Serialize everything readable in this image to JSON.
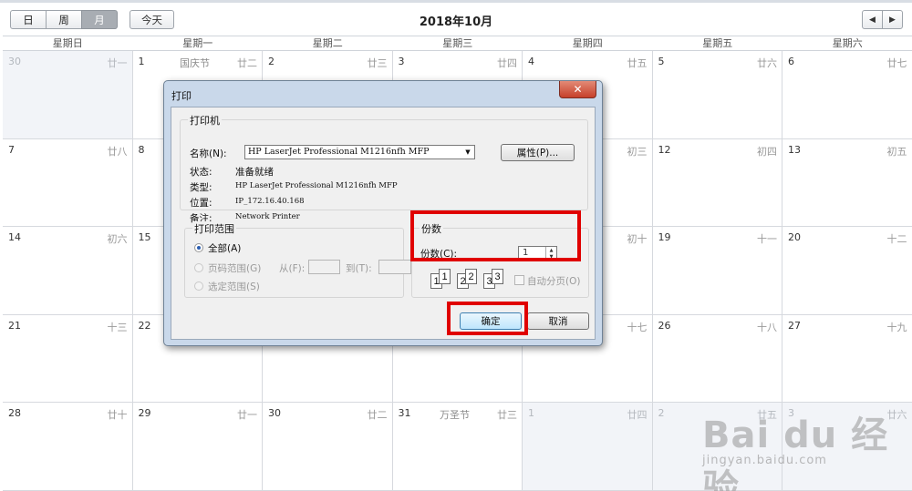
{
  "toolbar": {
    "view_day": "日",
    "view_week": "周",
    "view_month": "月",
    "today": "今天",
    "title": "2018年10月",
    "prev_icon": "◀",
    "next_icon": "▶"
  },
  "weekdays": [
    "星期日",
    "星期一",
    "星期二",
    "星期三",
    "星期四",
    "星期五",
    "星期六"
  ],
  "weeks": [
    [
      {
        "day": "30",
        "holiday": "",
        "lunar": "廿一",
        "other": true
      },
      {
        "day": "1",
        "holiday": "国庆节",
        "lunar": "廿二",
        "other": false
      },
      {
        "day": "2",
        "holiday": "",
        "lunar": "廿三",
        "other": false
      },
      {
        "day": "3",
        "holiday": "",
        "lunar": "廿四",
        "other": false
      },
      {
        "day": "4",
        "holiday": "",
        "lunar": "廿五",
        "other": false
      },
      {
        "day": "5",
        "holiday": "",
        "lunar": "廿六",
        "other": false
      },
      {
        "day": "6",
        "holiday": "",
        "lunar": "廿七",
        "other": false
      }
    ],
    [
      {
        "day": "7",
        "holiday": "",
        "lunar": "廿八",
        "other": false
      },
      {
        "day": "8",
        "holiday": "",
        "lunar": "",
        "other": false
      },
      {
        "day": "",
        "holiday": "",
        "lunar": "",
        "other": false
      },
      {
        "day": "",
        "holiday": "",
        "lunar": "",
        "other": false
      },
      {
        "day": "",
        "holiday": "",
        "lunar": "初三",
        "other": false
      },
      {
        "day": "12",
        "holiday": "",
        "lunar": "初四",
        "other": false
      },
      {
        "day": "13",
        "holiday": "",
        "lunar": "初五",
        "other": false
      }
    ],
    [
      {
        "day": "14",
        "holiday": "",
        "lunar": "初六",
        "other": false
      },
      {
        "day": "15",
        "holiday": "",
        "lunar": "",
        "other": false
      },
      {
        "day": "",
        "holiday": "",
        "lunar": "",
        "other": false
      },
      {
        "day": "",
        "holiday": "",
        "lunar": "",
        "other": false
      },
      {
        "day": "",
        "holiday": "",
        "lunar": "初十",
        "other": false
      },
      {
        "day": "19",
        "holiday": "",
        "lunar": "十一",
        "other": false
      },
      {
        "day": "20",
        "holiday": "",
        "lunar": "十二",
        "other": false
      }
    ],
    [
      {
        "day": "21",
        "holiday": "",
        "lunar": "十三",
        "other": false
      },
      {
        "day": "22",
        "holiday": "",
        "lunar": "",
        "other": false
      },
      {
        "day": "",
        "holiday": "",
        "lunar": "",
        "other": false
      },
      {
        "day": "",
        "holiday": "",
        "lunar": "",
        "other": false
      },
      {
        "day": "",
        "holiday": "",
        "lunar": "十七",
        "other": false
      },
      {
        "day": "26",
        "holiday": "",
        "lunar": "十八",
        "other": false
      },
      {
        "day": "27",
        "holiday": "",
        "lunar": "十九",
        "other": false
      }
    ],
    [
      {
        "day": "28",
        "holiday": "",
        "lunar": "廿十",
        "other": false
      },
      {
        "day": "29",
        "holiday": "",
        "lunar": "廿一",
        "other": false
      },
      {
        "day": "30",
        "holiday": "",
        "lunar": "廿二",
        "other": false
      },
      {
        "day": "31",
        "holiday": "万圣节",
        "lunar": "廿三",
        "other": false
      },
      {
        "day": "1",
        "holiday": "",
        "lunar": "廿四",
        "other": true
      },
      {
        "day": "2",
        "holiday": "",
        "lunar": "廿五",
        "other": true
      },
      {
        "day": "3",
        "holiday": "",
        "lunar": "廿六",
        "other": true
      }
    ]
  ],
  "dialog": {
    "title": "打印",
    "close_icon": "✕",
    "printer_group": "打印机",
    "name_label": "名称(N):",
    "printer_name": "HP LaserJet Professional M1216nfh MFP",
    "properties_button": "属性(P)...",
    "status_label": "状态:",
    "status_value": "准备就绪",
    "type_label": "类型:",
    "type_value": "HP LaserJet Professional M1216nfh MFP",
    "location_label": "位置:",
    "location_value": "IP_172.16.40.168",
    "comment_label": "备注:",
    "comment_value": "Network Printer",
    "range_group": "打印范围",
    "range_all": "全部(A)",
    "range_pages": "页码范围(G)",
    "from_label": "从(F):",
    "to_label": "到(T):",
    "range_selection": "选定范围(S)",
    "copies_group": "份数",
    "copies_label": "份数(C):",
    "copies_value": "1",
    "collate_label": "自动分页(O)",
    "collate_pages": [
      "1",
      "1",
      "2",
      "2",
      "3",
      "3"
    ],
    "ok_button": "确定",
    "cancel_button": "取消"
  },
  "watermark": {
    "main": "Bai du 经验",
    "sub": "jingyan.baidu.com"
  },
  "colors": {
    "highlight": "#e00000",
    "dialog_frame": "#c9d8ea",
    "other_month_bg": "#f2f4f8"
  }
}
